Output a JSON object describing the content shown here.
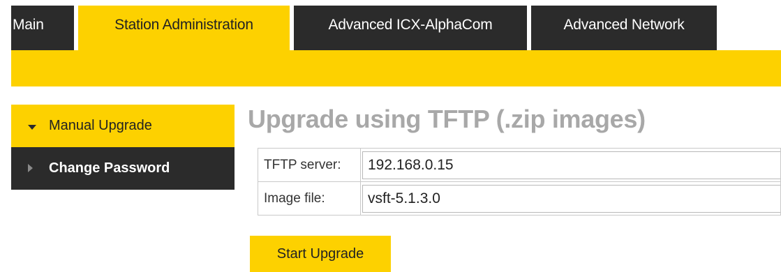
{
  "tabs": [
    {
      "label": "Main",
      "active": false
    },
    {
      "label": "Station Administration",
      "active": true
    },
    {
      "label": "Advanced ICX-AlphaCom",
      "active": false
    },
    {
      "label": "Advanced Network",
      "active": false
    }
  ],
  "sidebar": {
    "items": [
      {
        "label": "Manual Upgrade",
        "active": true,
        "icon": "caret-down-icon"
      },
      {
        "label": "Change Password",
        "active": false,
        "icon": "caret-right-icon"
      }
    ]
  },
  "main": {
    "title": "Upgrade using TFTP (.zip images)",
    "fields": [
      {
        "label": "TFTP server:",
        "value": "192.168.0.15"
      },
      {
        "label": "Image file:",
        "value": "vsft-5.1.3.0"
      }
    ],
    "start_button_label": "Start Upgrade"
  },
  "colors": {
    "accent": "#fdd100",
    "dark": "#2b2b2b",
    "title_gray": "#a8a8a8"
  }
}
